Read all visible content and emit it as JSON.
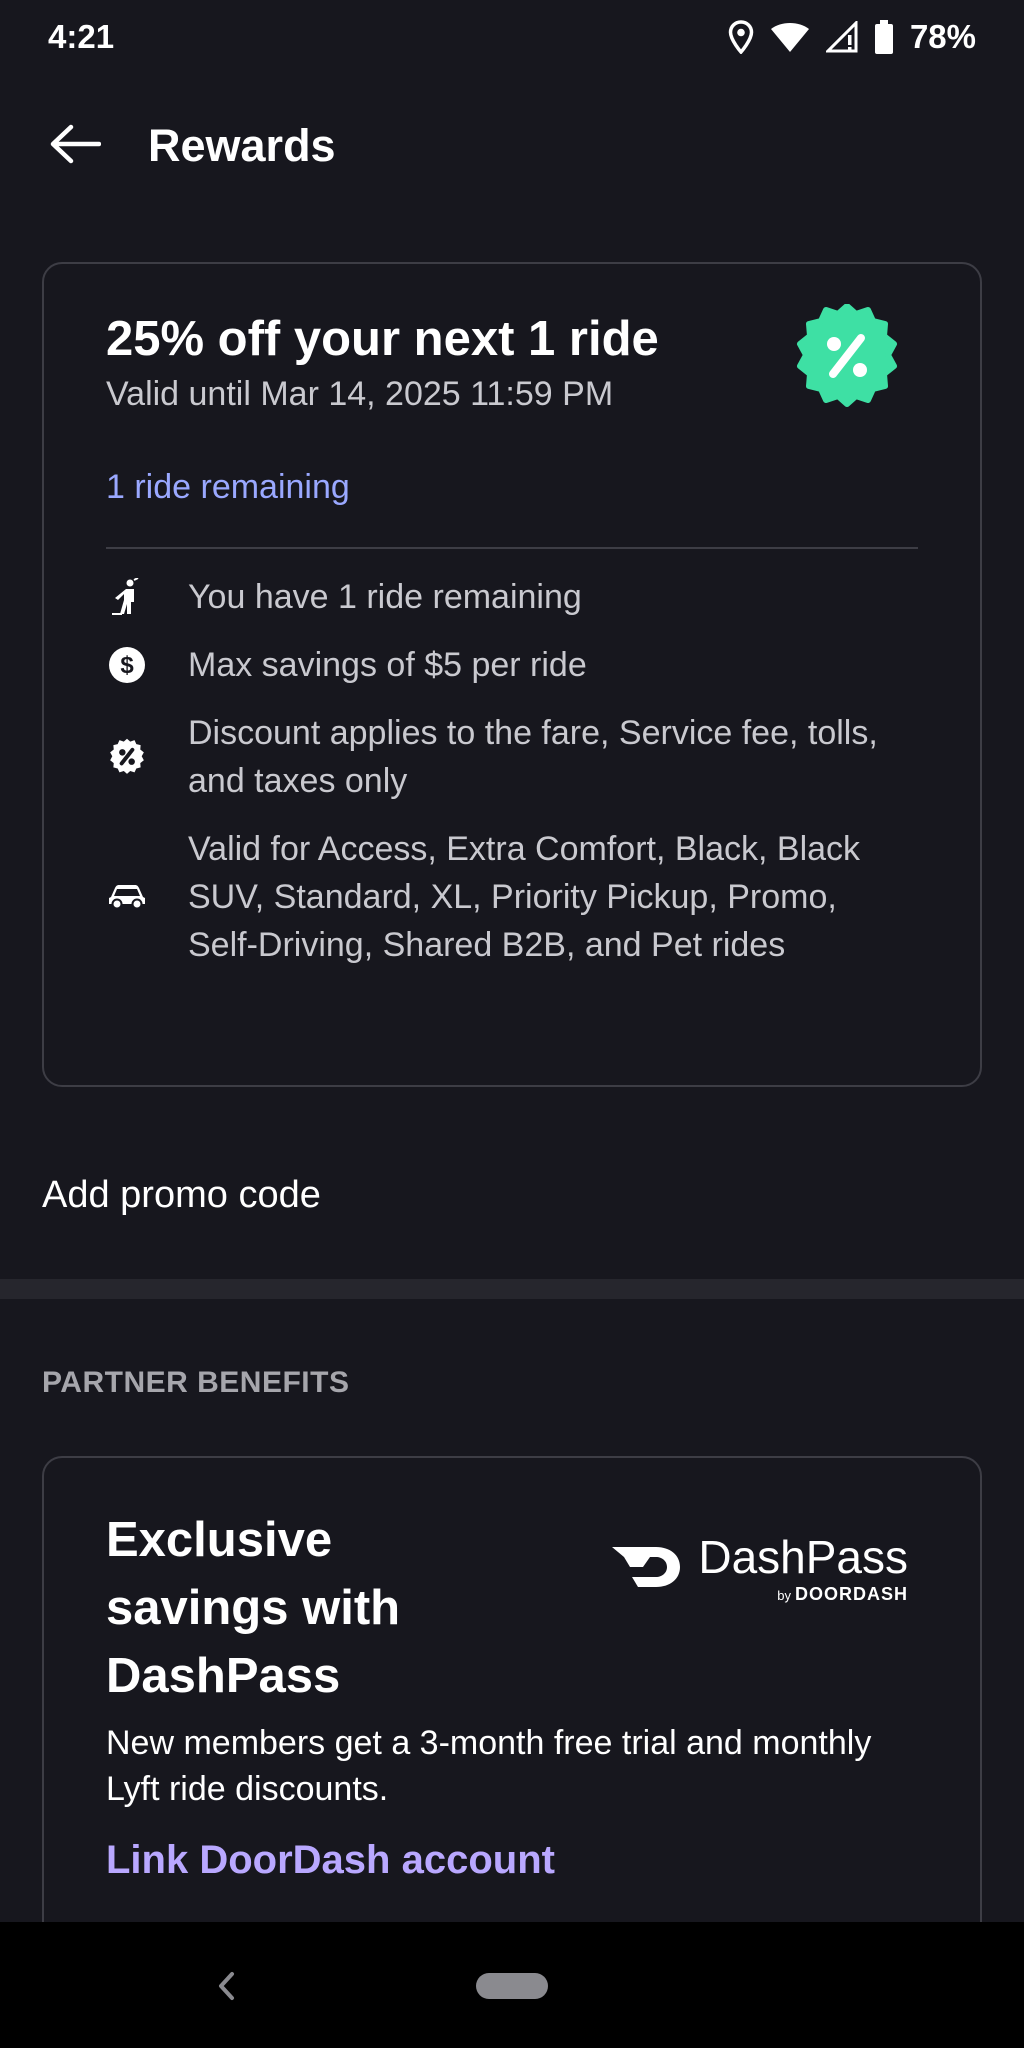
{
  "status_bar": {
    "time": "4:21",
    "battery": "78%",
    "icons": [
      "location-icon",
      "wifi-icon",
      "signal-icon",
      "battery-icon"
    ]
  },
  "header": {
    "title": "Rewards",
    "back_icon": "arrow-left-icon"
  },
  "reward": {
    "title": "25% off your next 1 ride",
    "valid_until": "Valid until Mar 14, 2025 11:59 PM",
    "remaining_link": "1 ride remaining",
    "badge_icon": "percent-badge-icon",
    "badge_color": "#3ee0a4",
    "details": [
      {
        "icon": "person-hailing-icon",
        "text": "You have 1 ride remaining"
      },
      {
        "icon": "dollar-circle-icon",
        "text": "Max savings of $5 per ride"
      },
      {
        "icon": "percent-badge-icon",
        "text": "Discount applies to the fare, Service fee, tolls, and taxes only"
      },
      {
        "icon": "car-icon",
        "text": "Valid for Access, Extra Comfort, Black, Black SUV, Standard, XL, Priority Pickup, Promo, Self-Driving, Shared B2B, and Pet rides"
      }
    ]
  },
  "promo": {
    "label": "Add promo code"
  },
  "partner_section": {
    "heading": "PARTNER BENEFITS",
    "card": {
      "title": "Exclusive savings with DashPass",
      "logo_main": "DashPass",
      "logo_by": "by",
      "logo_brand": "DOORDASH",
      "description": "New members get a 3-month free trial and monthly Lyft ride discounts.",
      "link": "Link DoorDash account"
    }
  },
  "colors": {
    "background": "#17171e",
    "link_blue": "#9aa8ff",
    "link_purple": "#b9a8ff",
    "accent_green": "#3ee0a4"
  }
}
